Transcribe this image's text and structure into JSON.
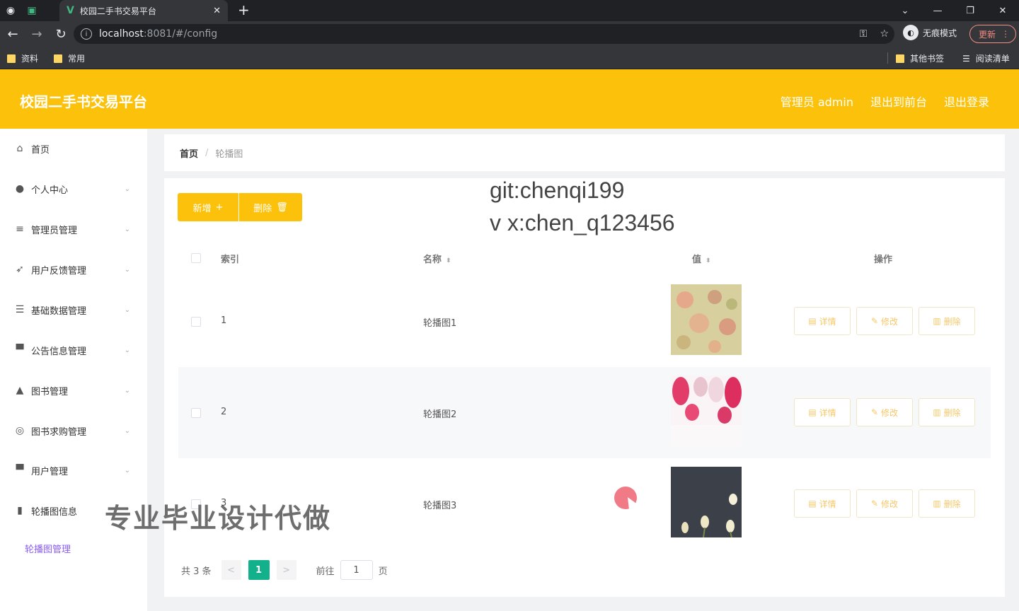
{
  "browser": {
    "tab_title": "校园二手书交易平台",
    "tab_close": "✕",
    "new_tab": "+",
    "url_host": "localhost",
    "url_path": ":8081/#/config",
    "incognito_label": "无痕模式",
    "update_label": "更新",
    "bookmarks": [
      "资料",
      "常用"
    ],
    "bookmarks_right": [
      "其他书签",
      "阅读清单"
    ]
  },
  "header": {
    "title": "校园二手书交易平台",
    "links": [
      "管理员 admin",
      "退出到前台",
      "退出登录"
    ]
  },
  "sidebar": {
    "items": [
      {
        "label": "首页",
        "icon": "home-icon",
        "has_arrow": false
      },
      {
        "label": "个人中心",
        "icon": "user-icon",
        "has_arrow": true
      },
      {
        "label": "管理员管理",
        "icon": "menu-icon",
        "has_arrow": true
      },
      {
        "label": "用户反馈管理",
        "icon": "send-icon",
        "has_arrow": true
      },
      {
        "label": "基础数据管理",
        "icon": "sliders-icon",
        "has_arrow": true
      },
      {
        "label": "公告信息管理",
        "icon": "monitor-icon",
        "has_arrow": true
      },
      {
        "label": "图书管理",
        "icon": "person-icon",
        "has_arrow": true
      },
      {
        "label": "图书求购管理",
        "icon": "circle-icon",
        "has_arrow": true
      },
      {
        "label": "用户管理",
        "icon": "monitor-icon",
        "has_arrow": true
      },
      {
        "label": "轮播图信息",
        "icon": "chart-icon",
        "has_arrow": true
      }
    ],
    "active_sub": "轮播图管理"
  },
  "breadcrumb": {
    "home": "首页",
    "separator": "/",
    "current": "轮播图"
  },
  "toolbar": {
    "add_label": "新增",
    "delete_label": "删除"
  },
  "overlay": {
    "git_line": "git:chenqi199",
    "vx_line": "v x:chen_q123456",
    "cn_watermark": "专业毕业设计代做"
  },
  "table": {
    "headers": {
      "index": "索引",
      "name": "名称",
      "value": "值",
      "ops": "操作"
    },
    "rows": [
      {
        "index": "1",
        "name": "轮播图1",
        "thumb": "floral-beige"
      },
      {
        "index": "2",
        "name": "轮播图2",
        "thumb": "pink-tulips"
      },
      {
        "index": "3",
        "name": "轮播图3",
        "thumb": "dark-flowers"
      }
    ],
    "op_labels": {
      "detail": "详情",
      "edit": "修改",
      "delete": "删除"
    }
  },
  "pagination": {
    "total": "共 3 条",
    "prev": "<",
    "current": "1",
    "next": ">",
    "goto_label": "前往",
    "goto_value": "1",
    "page_unit": "页"
  },
  "colors": {
    "brand": "#fcc20b",
    "pager_active": "#13b08c",
    "sub_active": "#8a5cf5"
  }
}
